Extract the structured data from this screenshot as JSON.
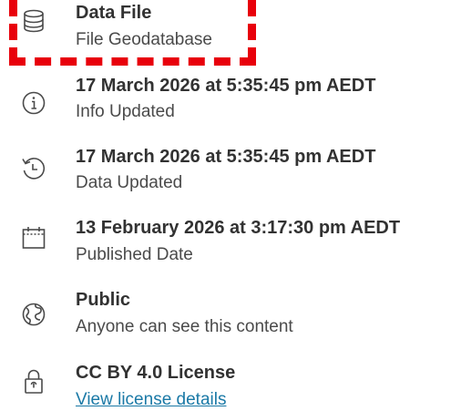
{
  "items": [
    {
      "icon": "database-icon",
      "title": "Data File",
      "subtitle": "File Geodatabase"
    },
    {
      "icon": "info-icon",
      "title": "17 March 2026 at 5:35:45 pm AEDT",
      "subtitle": "Info Updated"
    },
    {
      "icon": "history-icon",
      "title": "17 March 2026 at 5:35:45 pm AEDT",
      "subtitle": "Data Updated"
    },
    {
      "icon": "calendar-icon",
      "title": "13 February 2026 at 3:17:30 pm AEDT",
      "subtitle": "Published Date"
    },
    {
      "icon": "globe-icon",
      "title": "Public",
      "subtitle": "Anyone can see this content"
    },
    {
      "icon": "license-lock-icon",
      "title": "CC BY 4.0 License",
      "subtitle": "View license details"
    }
  ],
  "colors": {
    "highlight": "#e8000b",
    "link": "#1a79a6",
    "text": "#323232"
  }
}
